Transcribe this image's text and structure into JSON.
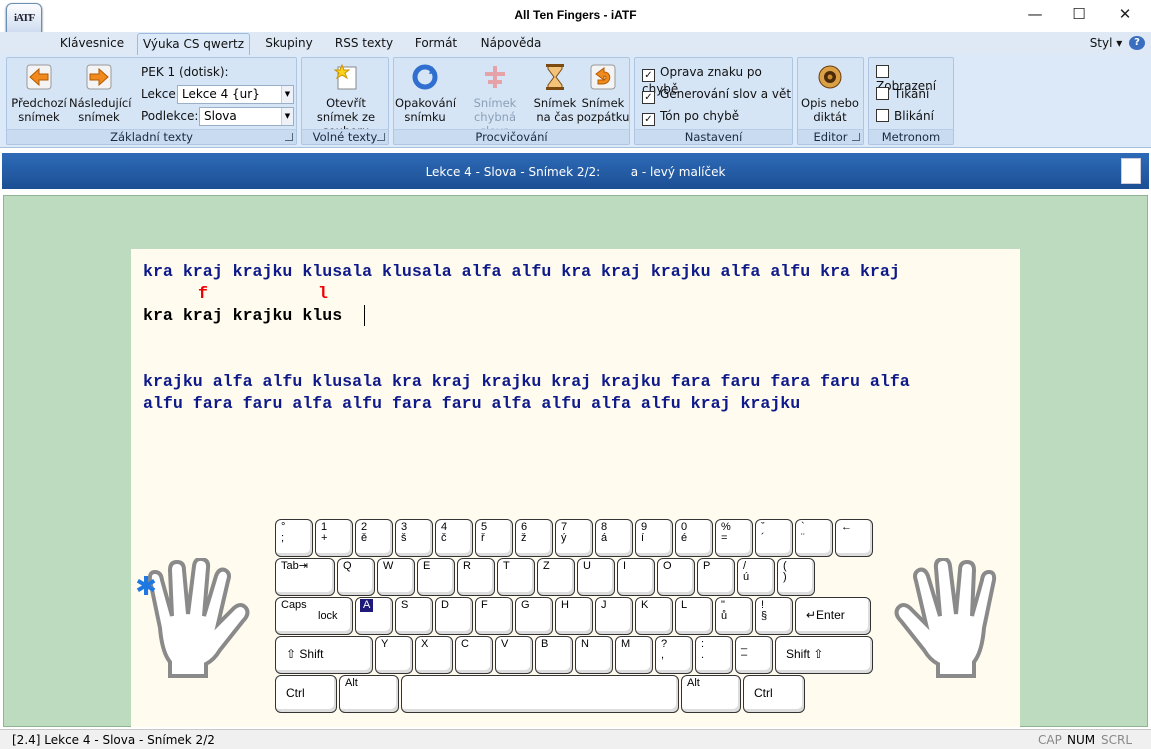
{
  "window": {
    "title": "All Ten Fingers - iATF",
    "app_icon_text": "iATF"
  },
  "menu": {
    "tabs": [
      "Klávesnice",
      "Výuka CS qwertz",
      "Skupiny",
      "RSS texty",
      "Formát",
      "Nápověda"
    ],
    "style_label": "Styl",
    "help_label": "?"
  },
  "ribbon": {
    "zakladni": {
      "label": "Základní texty",
      "prev": "Předchozí snímek",
      "next": "Následující snímek",
      "pek": "PEK 1 (dotisk):",
      "lekce_label": "Lekce:",
      "lekce_value": "Lekce  4 {ur}",
      "podlekce_label": "Podlekce:",
      "podlekce_value": "Slova"
    },
    "volne": {
      "label": "Volné texty",
      "open": "Otevřít snímek ze souboru"
    },
    "procvic": {
      "label": "Procvičování",
      "repeat": "Opakování snímku",
      "wrong": "Snímek chybná slova",
      "timed": "Snímek na čas",
      "back": "Snímek pozpátku"
    },
    "nastaveni": {
      "label": "Nastavení",
      "opt1": "Oprava znaku po chybě",
      "opt2": "Generování slov a vět",
      "opt3": "Tón po chybě"
    },
    "editor": {
      "label": "Editor",
      "dict": "Opis nebo diktát"
    },
    "metronom": {
      "label": "Metronom",
      "opt1": "Zobrazení",
      "opt2": "Tikání",
      "opt3": "Blikání"
    }
  },
  "infobar": {
    "text": "Lekce 4 - Slova - Snímek 2/2:        a - levý malíček"
  },
  "exercise": {
    "line1": "kra kraj krajku klusala klusala alfa alfu kra kraj krajku alfa alfu kra kraj",
    "errors": [
      "f",
      "l"
    ],
    "typed": "kra kraj krajku klus",
    "line2": "krajku alfa alfu klusala kra kraj krajku kraj krajku fara faru fara faru alfa",
    "line3": "alfu fara faru alfa alfu fara faru alfa alfu alfa alfu kraj krajku"
  },
  "keyboard": {
    "row1": [
      [
        "°",
        ";"
      ],
      [
        "1",
        "+"
      ],
      [
        "2",
        "ě"
      ],
      [
        "3",
        "š"
      ],
      [
        "4",
        "č"
      ],
      [
        "5",
        "ř"
      ],
      [
        "6",
        "ž"
      ],
      [
        "7",
        "ý"
      ],
      [
        "8",
        "á"
      ],
      [
        "9",
        "í"
      ],
      [
        "0",
        "é"
      ],
      [
        "%",
        "="
      ],
      [
        "ˇ",
        "´"
      ],
      [
        "`",
        "¨"
      ],
      [
        "←",
        ""
      ]
    ],
    "row2": [
      [
        "Tab⇥",
        ""
      ],
      [
        "Q",
        ""
      ],
      [
        "W",
        ""
      ],
      [
        "E",
        ""
      ],
      [
        "R",
        ""
      ],
      [
        "T",
        ""
      ],
      [
        "Z",
        ""
      ],
      [
        "U",
        ""
      ],
      [
        "I",
        ""
      ],
      [
        "O",
        ""
      ],
      [
        "P",
        ""
      ],
      [
        "/",
        "ú"
      ],
      [
        "(",
        ")"
      ]
    ],
    "row3": [
      [
        "Caps",
        "lock"
      ],
      [
        "A",
        ""
      ],
      [
        "S",
        ""
      ],
      [
        "D",
        ""
      ],
      [
        "F",
        ""
      ],
      [
        "G",
        ""
      ],
      [
        "H",
        ""
      ],
      [
        "J",
        ""
      ],
      [
        "K",
        ""
      ],
      [
        "L",
        ""
      ],
      [
        "\"",
        "ů"
      ],
      [
        "!",
        "§"
      ],
      [
        "↵Enter",
        ""
      ]
    ],
    "row4": [
      [
        "⇧ Shift",
        ""
      ],
      [
        "Y",
        ""
      ],
      [
        "X",
        ""
      ],
      [
        "C",
        ""
      ],
      [
        "V",
        ""
      ],
      [
        "B",
        ""
      ],
      [
        "N",
        ""
      ],
      [
        "M",
        ""
      ],
      [
        "?",
        ","
      ],
      [
        ":",
        "."
      ],
      [
        "_",
        "–"
      ],
      [
        "Shift ⇧",
        ""
      ]
    ],
    "row5": [
      [
        "Ctrl",
        ""
      ],
      [
        "Alt",
        ""
      ],
      [
        "",
        ""
      ],
      [
        "Alt",
        ""
      ],
      [
        "Ctrl",
        ""
      ]
    ],
    "highlight": "A"
  },
  "statusbar": {
    "left": "[2.4]  Lekce 4 - Slova - Snímek 2/2",
    "cap": "CAP",
    "num": "NUM",
    "scrl": "SCRL"
  }
}
